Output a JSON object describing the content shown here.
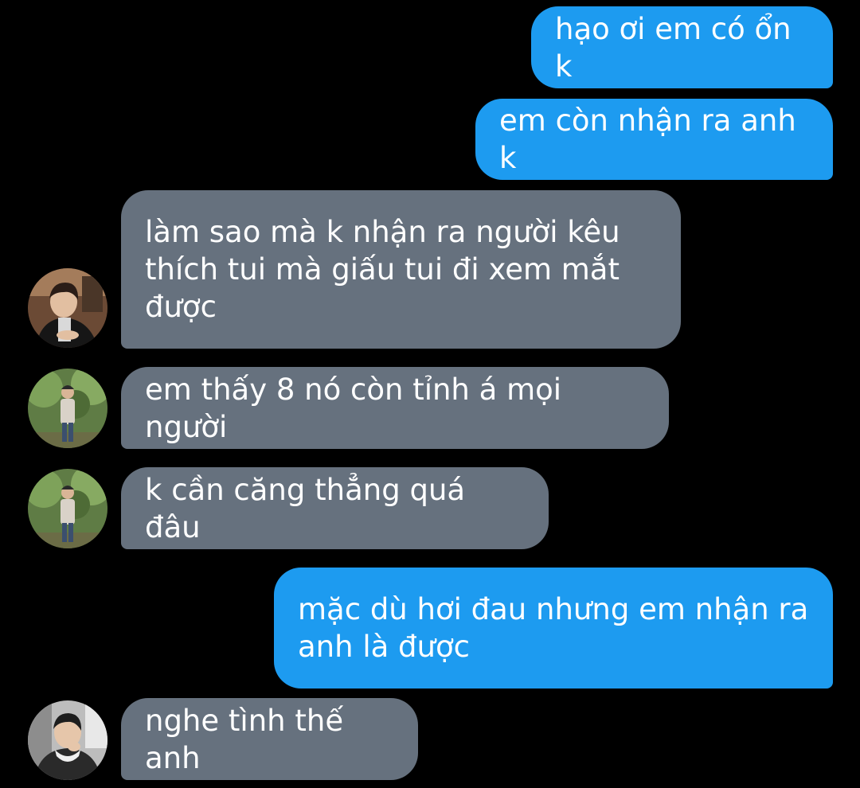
{
  "messages": [
    {
      "from": "me",
      "text": "hạo ơi em có ổn k"
    },
    {
      "from": "me",
      "text": "em còn nhận ra anh k"
    },
    {
      "from": "them",
      "avatar": "avatar-indoor-icon",
      "text": "làm sao mà k nhận ra người kêu\nthích tui mà giấu tui đi xem mắt\nđược"
    },
    {
      "from": "them",
      "avatar": "avatar-park-icon",
      "text": "em thấy 8 nó còn tỉnh á mọi người"
    },
    {
      "from": "them",
      "avatar": "avatar-park-icon",
      "text": "k cần căng thẳng quá đâu"
    },
    {
      "from": "me",
      "text": "mặc dù hơi đau nhưng em nhận ra\nanh là được"
    },
    {
      "from": "them",
      "avatar": "avatar-hoodie-icon",
      "text": "nghe tình thế anh"
    }
  ],
  "colors": {
    "background": "#000000",
    "outgoing": "#1d9bf0",
    "incoming": "#66717e",
    "text": "#ffffff"
  }
}
